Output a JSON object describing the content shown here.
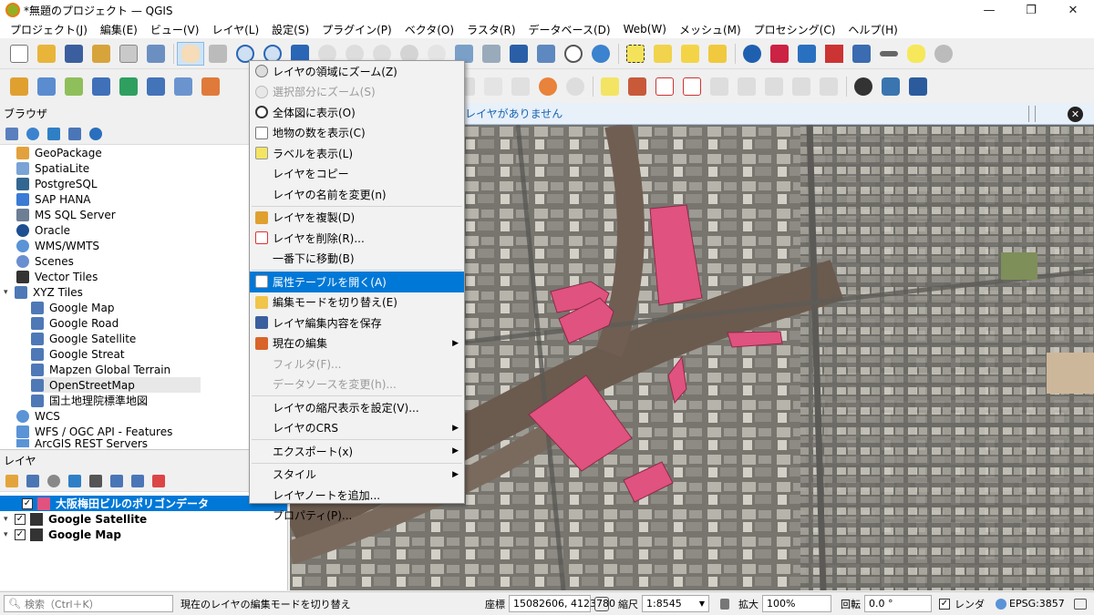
{
  "window": {
    "title": "*無題のプロジェクト — QGIS"
  },
  "menubar": [
    "プロジェクト(J)",
    "編集(E)",
    "ビュー(V)",
    "レイヤ(L)",
    "設定(S)",
    "プラグイン(P)",
    "ベクタ(O)",
    "ラスタ(R)",
    "データベース(D)",
    "Web(W)",
    "メッシュ(M)",
    "プロセシング(C)",
    "ヘルプ(H)"
  ],
  "browser": {
    "title": "ブラウザ",
    "items": [
      "GeoPackage",
      "SpatiaLite",
      "PostgreSQL",
      "SAP HANA",
      "MS SQL Server",
      "Oracle",
      "WMS/WMTS",
      "Scenes",
      "Vector Tiles",
      "XYZ Tiles",
      "Google Map",
      "Google Road",
      "Google Satellite",
      "Google Streat",
      "Mapzen Global Terrain",
      "OpenStreetMap",
      "国土地理院標準地図",
      "WCS",
      "WFS / OGC API - Features",
      "ArcGIS REST Servers"
    ]
  },
  "layers": {
    "title": "レイヤ",
    "items": [
      "大阪梅田ビルのポリゴンデータ",
      "Google Satellite",
      "Google Map"
    ]
  },
  "message_bar": {
    "text": "レイヤがありません"
  },
  "context_menu": {
    "items": [
      {
        "label": "レイヤの領域にズーム(Z)"
      },
      {
        "label": "選択部分にズーム(S)"
      },
      {
        "label": "全体図に表示(O)"
      },
      {
        "label": "地物の数を表示(C)"
      },
      {
        "label": "ラベルを表示(L)"
      },
      {
        "label": "レイヤをコピー"
      },
      {
        "label": "レイヤの名前を変更(n)"
      },
      {
        "label": "レイヤを複製(D)"
      },
      {
        "label": "レイヤを削除(R)..."
      },
      {
        "label": "一番下に移動(B)"
      },
      {
        "label": "属性テーブルを開く(A)"
      },
      {
        "label": "編集モードを切り替え(E)"
      },
      {
        "label": "レイヤ編集内容を保存"
      },
      {
        "label": "現在の編集"
      },
      {
        "label": "フィルタ(F)..."
      },
      {
        "label": "データソースを変更(h)..."
      },
      {
        "label": "レイヤの縮尺表示を設定(V)..."
      },
      {
        "label": "レイヤのCRS"
      },
      {
        "label": "エクスポート(x)"
      },
      {
        "label": "スタイル"
      },
      {
        "label": "レイヤノートを追加..."
      },
      {
        "label": "プロパティ(P)..."
      }
    ]
  },
  "status": {
    "search_placeholder": "検索（Ctrl＋K）",
    "message": "現在のレイヤの編集モードを切り替え",
    "coord_label": "座標",
    "coord_value": "15082606, 4123780",
    "scale_label": "縮尺",
    "scale_value": "1:8545",
    "magnify_label": "拡大",
    "magnify_value": "100%",
    "rotation_label": "回転",
    "rotation_value": "0.0 °",
    "render_label": "レンダ",
    "crs": "EPSG:3857"
  },
  "colors": {
    "accent": "#0078d7",
    "polygon": "#e0527f",
    "map_bg": "#6e6c66"
  }
}
